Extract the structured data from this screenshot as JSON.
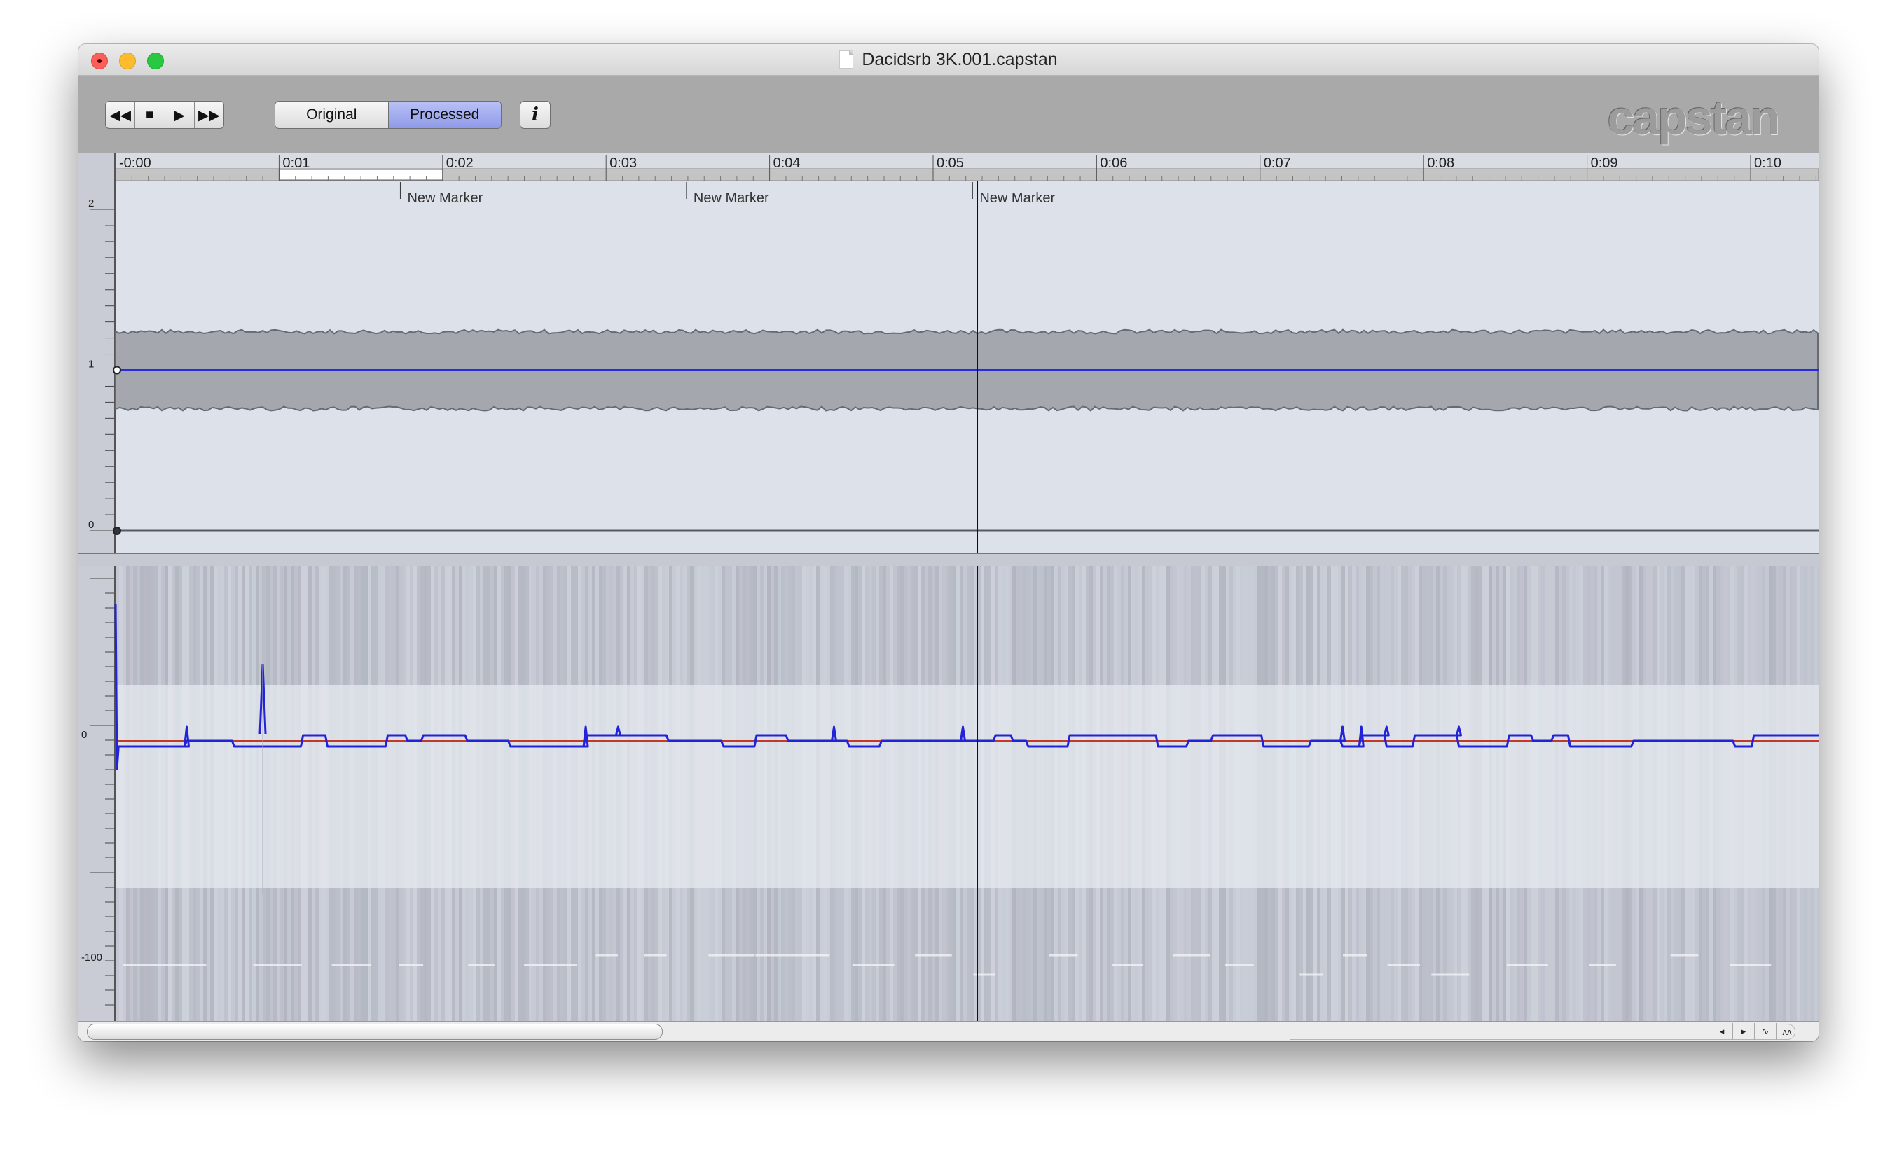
{
  "window": {
    "title": "Dacidsrb 3K.001.capstan"
  },
  "toolbar": {
    "transport": [
      {
        "name": "rewind-button",
        "glyph": "◀◀"
      },
      {
        "name": "stop-button",
        "glyph": "■"
      },
      {
        "name": "play-button",
        "glyph": "▶"
      },
      {
        "name": "fast-forward-button",
        "glyph": "▶▶"
      }
    ],
    "modes": [
      {
        "label": "Original",
        "active": false
      },
      {
        "label": "Processed",
        "active": true
      }
    ],
    "info_label": "i",
    "logo": "capstan"
  },
  "timeline": {
    "ticks": [
      "-0:00",
      "0:01",
      "0:02",
      "0:03",
      "0:04",
      "0:05",
      "0:06",
      "0:07",
      "0:08",
      "0:09",
      "0:10"
    ],
    "selection_sec": [
      1.0,
      2.0
    ],
    "markers": [
      {
        "label": "New Marker",
        "time": 1.75
      },
      {
        "label": "New Marker",
        "time": 3.5
      },
      {
        "label": "New Marker",
        "time": 5.25
      }
    ],
    "playhead_sec": 5.27
  },
  "top_lane": {
    "y_labels": [
      "2",
      "1",
      "0"
    ],
    "range": [
      0,
      2
    ]
  },
  "bottom_lane": {
    "y_labels": [
      "0",
      "-100"
    ]
  },
  "scroll": {
    "icons": [
      "scroll-left-icon",
      "scroll-right-icon",
      "waveform-small-icon",
      "waveform-large-icon"
    ],
    "glyphs": [
      "◂",
      "▸",
      "∿",
      "ᴧᴧ"
    ]
  }
}
